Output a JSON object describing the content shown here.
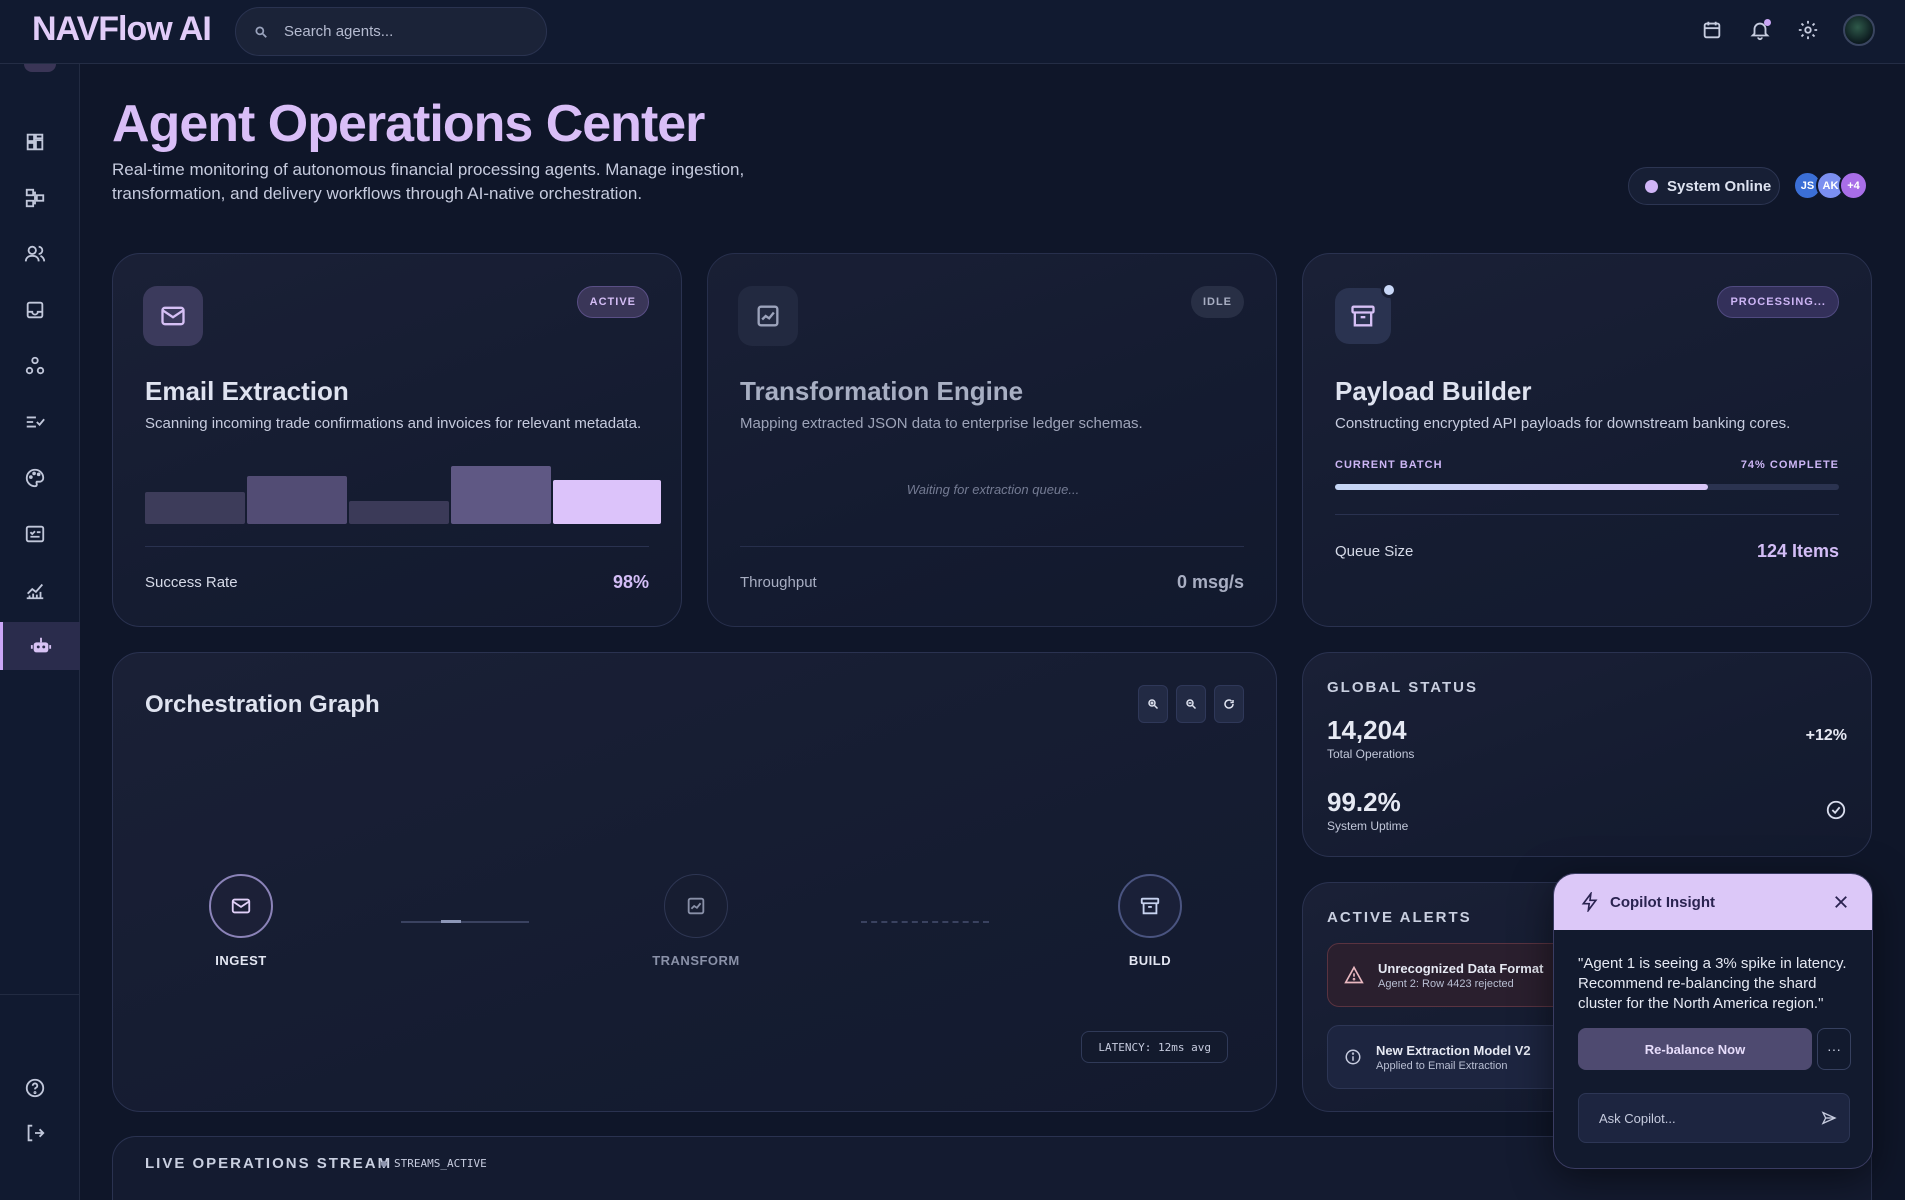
{
  "app": {
    "brand": "NAVFlow AI",
    "search_placeholder": "Search agents..."
  },
  "topbar": {
    "icons": [
      "calendar-icon",
      "bell-icon",
      "gear-icon",
      "avatar"
    ]
  },
  "sidebar": {
    "items": [
      {
        "name": "dashboard-icon",
        "active": false
      },
      {
        "name": "workflow-icon",
        "active": false
      },
      {
        "name": "users-icon",
        "active": false
      },
      {
        "name": "inbox-icon",
        "active": false
      },
      {
        "name": "nodes-icon",
        "active": false
      },
      {
        "name": "tasks-icon",
        "active": false
      },
      {
        "name": "palette-icon",
        "active": false
      },
      {
        "name": "checklist-icon",
        "active": false
      },
      {
        "name": "analytics-icon",
        "active": false
      },
      {
        "name": "robot-icon",
        "active": true
      }
    ],
    "bottom": [
      "help-icon",
      "logout-icon"
    ]
  },
  "header": {
    "title": "Agent Operations Center",
    "description": "Real-time monitoring of autonomous financial processing agents. Manage ingestion, transformation, and delivery workflows through AI-native orchestration.",
    "status": "System Online",
    "avatars": [
      {
        "label": "JS",
        "color": "#3b6fd6"
      },
      {
        "label": "AK",
        "color": "#7b8ff0"
      },
      {
        "label": "+4",
        "color": "#a86ee8"
      }
    ]
  },
  "agents": [
    {
      "title": "Email Extraction",
      "description": "Scanning incoming trade confirmations and invoices for relevant metadata.",
      "badge": "ACTIVE",
      "stat_label": "Success Rate",
      "stat_value": "98%",
      "bar_levels": [
        0.55,
        0.82,
        0.4,
        1.0,
        0.75
      ]
    },
    {
      "title": "Transformation Engine",
      "description": "Mapping extracted JSON data to enterprise ledger schemas.",
      "badge": "IDLE",
      "waiting": "Waiting for extraction queue...",
      "stat_label": "Throughput",
      "stat_value": "0 msg/s"
    },
    {
      "title": "Payload Builder",
      "description": "Constructing encrypted API payloads for downstream banking cores.",
      "badge": "PROCESSING...",
      "batch_label": "CURRENT BATCH",
      "batch_complete": "74% COMPLETE",
      "batch_progress": 0.74,
      "stat_label": "Queue Size",
      "stat_value": "124 Items"
    }
  ],
  "graph": {
    "title": "Orchestration Graph",
    "nodes": [
      "INGEST",
      "TRANSFORM",
      "BUILD"
    ],
    "latency": "LATENCY: 12ms avg"
  },
  "global_status": {
    "label": "GLOBAL STATUS",
    "total_ops": "14,204",
    "total_ops_label": "Total Operations",
    "change": "+12%",
    "uptime": "99.2%",
    "uptime_label": "System Uptime"
  },
  "alerts": {
    "label": "ACTIVE ALERTS",
    "items": [
      {
        "title": "Unrecognized Data Format",
        "subtitle": "Agent 2: Row 4423 rejected"
      },
      {
        "title": "New Extraction Model V2",
        "subtitle": "Applied to Email Extraction"
      }
    ]
  },
  "copilot": {
    "title": "Copilot Insight",
    "message": "\"Agent 1 is seeing a 3% spike in latency. Recommend re-balancing the shard cluster for the North America region.\"",
    "action": "Re-balance Now",
    "more": "···",
    "ask_placeholder": "Ask Copilot..."
  },
  "stream": {
    "title": "LIVE OPERATIONS STREAM",
    "tag": "STREAMS_ACTIVE"
  }
}
